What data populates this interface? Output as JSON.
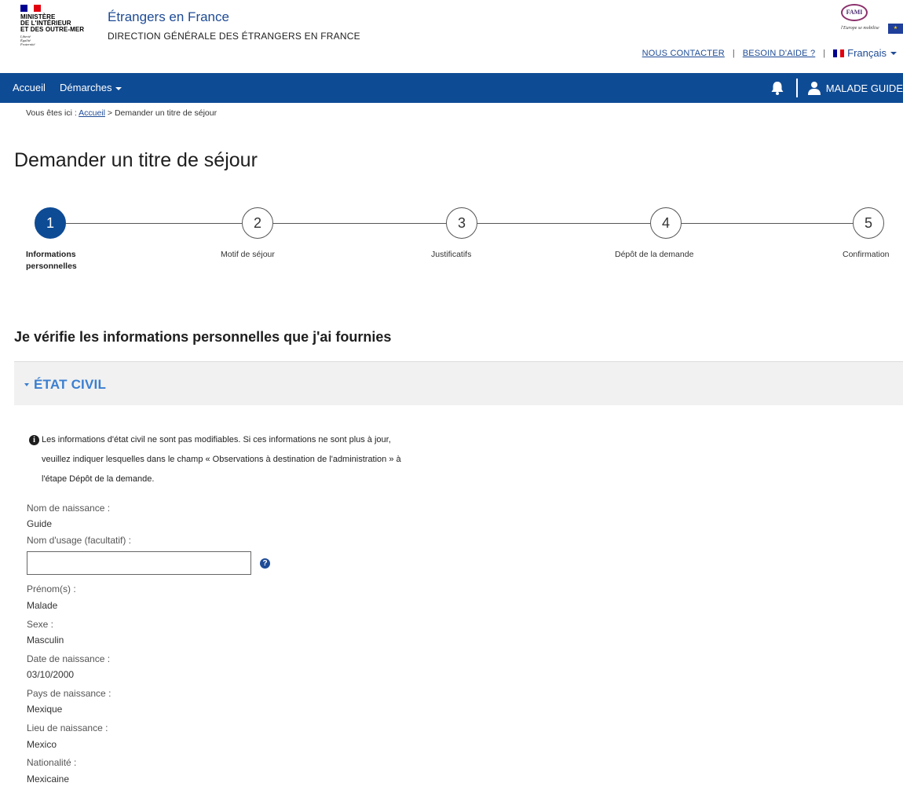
{
  "header": {
    "ministry_lines": [
      "MINISTÈRE",
      "DE L'INTÉRIEUR",
      "ET DES OUTRE-MER"
    ],
    "ministry_motto": [
      "Liberté",
      "Égalité",
      "Fraternité"
    ],
    "site_title": "Étrangers en France",
    "site_subtitle": "DIRECTION GÉNÉRALE DES ÉTRANGERS EN FRANCE",
    "fami_logo_text": "FAMI",
    "fami_tagline": "l'Europe se mobilise",
    "links": {
      "contact": "NOUS CONTACTER",
      "help": "BESOIN D'AIDE ?",
      "language": "Français"
    }
  },
  "navbar": {
    "home": "Accueil",
    "procedures": "Démarches",
    "user_name": "MALADE GUIDE"
  },
  "breadcrumb": {
    "prefix": "Vous êtes ici : ",
    "home": "Accueil",
    "separator": " > ",
    "current": "Demander un titre de séjour"
  },
  "page_title": "Demander un titre de séjour",
  "stepper": {
    "steps": [
      {
        "number": "1",
        "label_line1": "Informations",
        "label_line2": "personnelles",
        "active": true
      },
      {
        "number": "2",
        "label_line1": "Motif de séjour",
        "active": false
      },
      {
        "number": "3",
        "label_line1": "Justificatifs",
        "active": false
      },
      {
        "number": "4",
        "label_line1": "Dépôt de la demande",
        "active": false
      },
      {
        "number": "5",
        "label_line1": "Confirmation",
        "active": false
      }
    ]
  },
  "section_heading": "Je vérifie les informations personnelles que j'ai fournies",
  "accordion": {
    "title": "ÉTAT CIVIL"
  },
  "info_notice": {
    "line1": "Les informations d'état civil ne sont pas modifiables. Si ces informations ne sont plus à jour,",
    "line2": "veuillez indiquer lesquelles dans le champ « Observations à destination de l'administration » à",
    "line3": "l'étape Dépôt de la demande."
  },
  "fields": {
    "birth_name_label": "Nom de naissance :",
    "birth_name_value": "Guide",
    "usage_name_label": "Nom d'usage (facultatif) :",
    "usage_name_value": "",
    "first_names_label": "Prénom(s) :",
    "first_names_value": "Malade",
    "sex_label": "Sexe :",
    "sex_value": "Masculin",
    "birth_date_label": "Date de naissance :",
    "birth_date_value": "03/10/2000",
    "birth_country_label": "Pays de naissance :",
    "birth_country_value": "Mexique",
    "birth_place_label": "Lieu de naissance :",
    "birth_place_value": "Mexico",
    "nationality_label": "Nationalité :",
    "nationality_value": "Mexicaine"
  },
  "colors": {
    "nav_blue": "#0e4b95",
    "link_blue": "#1e4b96",
    "accordion_blue": "#3a7fd0",
    "flag_blue": "#000091",
    "flag_red": "#e1000f"
  }
}
